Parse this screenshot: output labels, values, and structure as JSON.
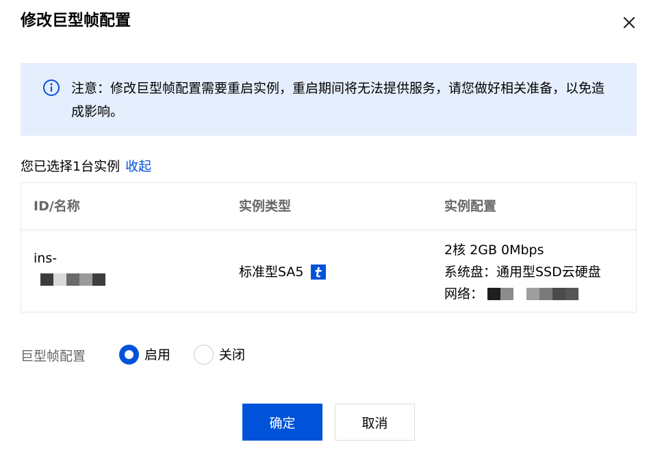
{
  "dialog": {
    "title": "修改巨型帧配置"
  },
  "notice": {
    "text": "注意：修改巨型帧配置需要重启实例，重启期间将无法提供服务，请您做好相关准备，以免造成影响。"
  },
  "selection": {
    "summary": "您已选择1台实例",
    "collapse_label": "收起"
  },
  "table": {
    "headers": [
      "ID/名称",
      "实例类型",
      "实例配置"
    ],
    "rows": [
      {
        "id_prefix": "ins-",
        "type": "标准型SA5",
        "config_line1": "2核 2GB 0Mbps",
        "config_line2": "系统盘：通用型SSD云硬盘",
        "network_label": "网络："
      }
    ]
  },
  "jumbo_frame": {
    "label": "巨型帧配置",
    "options": [
      "启用",
      "关闭"
    ],
    "selected": "启用"
  },
  "footer": {
    "confirm_label": "确定",
    "cancel_label": "取消"
  },
  "colors": {
    "primary": "#0052d9",
    "notice_bg": "#e5eefd",
    "muted_text": "#666666"
  },
  "icons": {
    "close": "close-icon",
    "info": "info-icon",
    "instance_type_badge": "t-badge-icon"
  }
}
